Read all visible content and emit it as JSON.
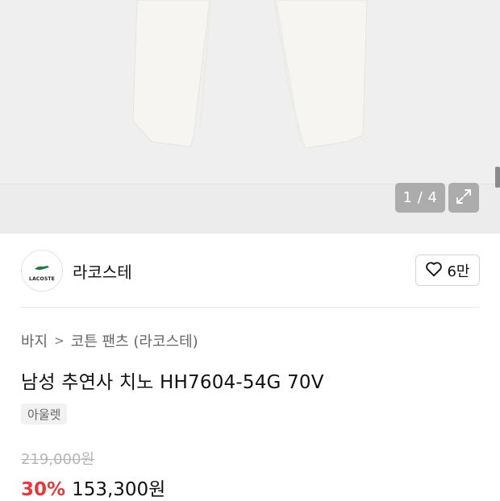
{
  "gallery": {
    "counter": "1 / 4",
    "current_page": 1,
    "total_pages": 4
  },
  "brand": {
    "logo_text": "LACOSTE",
    "name": "라코스테"
  },
  "like": {
    "count": "6만"
  },
  "breadcrumb": {
    "items": [
      "바지",
      "코튼 팬츠 (라코스테)"
    ]
  },
  "product": {
    "title": "남성 추연사 치노 HH7604-54G 70V",
    "tag": "아울렛",
    "original_price": "219,000원",
    "discount": "30%",
    "sale_price": "153,300원"
  },
  "colors": {
    "discount": "#e8373a",
    "gallery_bg": "#efefef",
    "product": "#f6f5f1"
  }
}
